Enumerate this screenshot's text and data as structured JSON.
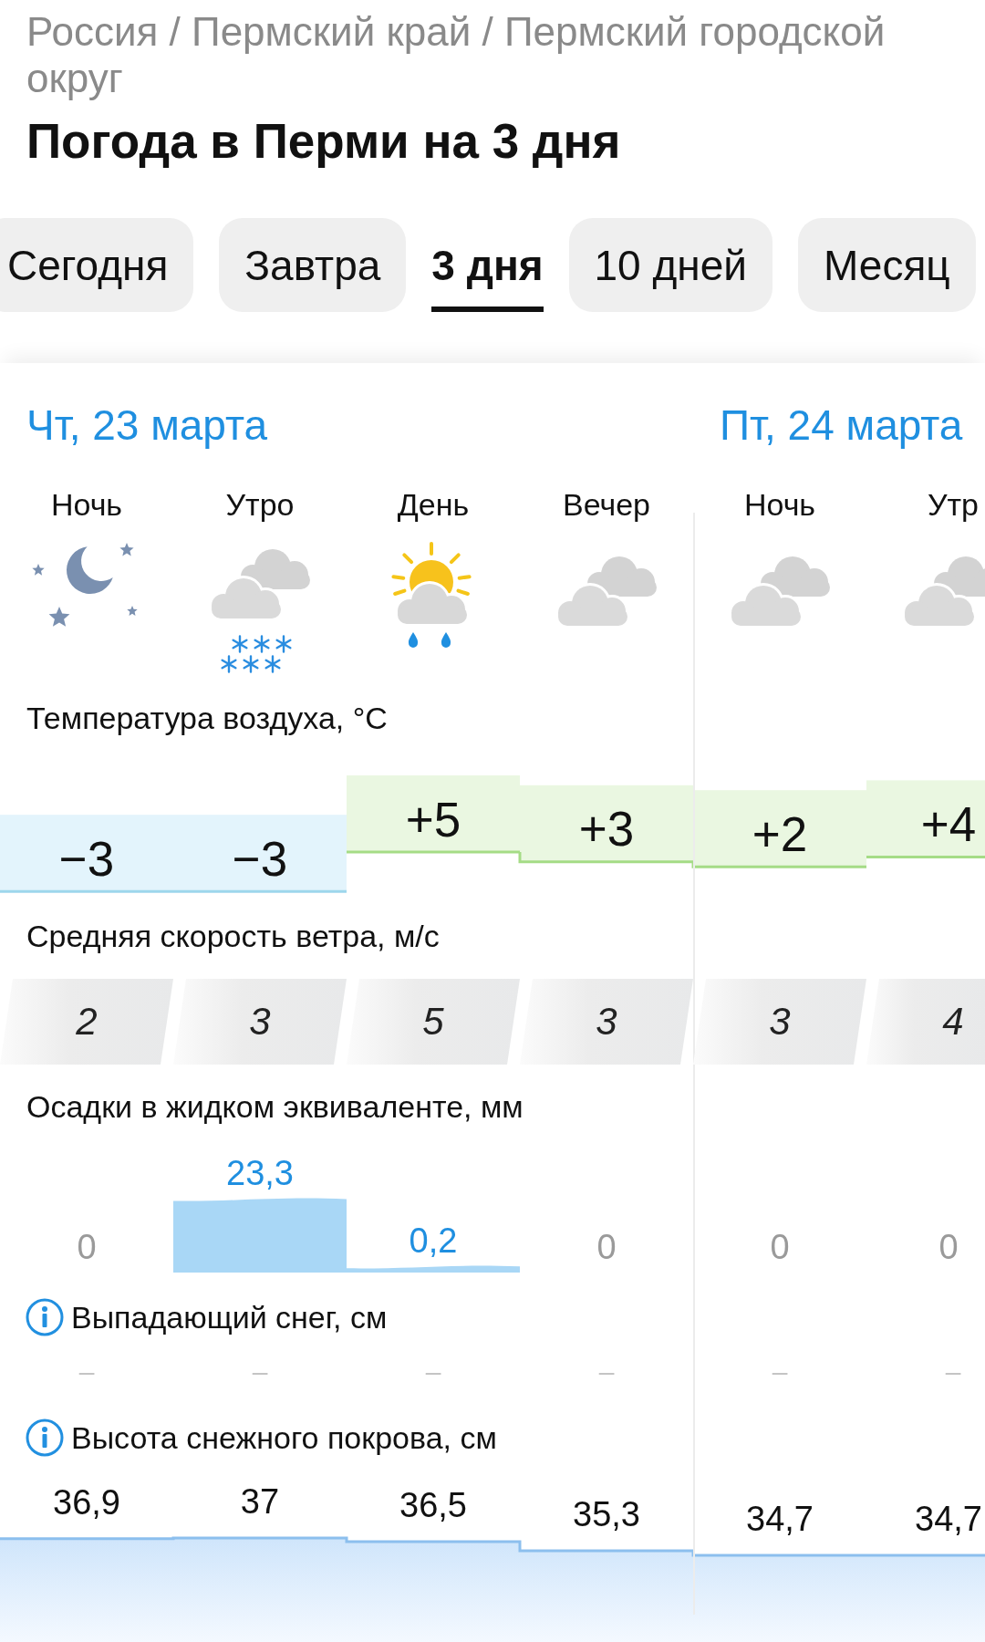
{
  "breadcrumb": {
    "items": [
      "Россия",
      "Пермский край",
      "Пермский городской округ"
    ],
    "separator": "/"
  },
  "title": "Погода в Перми на 3 дня",
  "tabs": [
    {
      "label": "Сегодня",
      "selected": false
    },
    {
      "label": "Завтра",
      "selected": false
    },
    {
      "label": "3 дня",
      "selected": true
    },
    {
      "label": "10 дней",
      "selected": false
    },
    {
      "label": "Месяц",
      "selected": false
    }
  ],
  "days": [
    {
      "label": "Чт, 23 марта",
      "periods": [
        {
          "label": "Ночь",
          "kind": "clear-night"
        },
        {
          "label": "Утро",
          "kind": "snow"
        },
        {
          "label": "День",
          "kind": "partly-cloudy-rain"
        },
        {
          "label": "Вечер",
          "kind": "overcast"
        }
      ]
    },
    {
      "label": "Пт, 24 марта",
      "periods": [
        {
          "label": "Ночь",
          "kind": "overcast"
        },
        {
          "label": "Утр",
          "kind": "overcast"
        }
      ]
    }
  ],
  "temperature": {
    "title": "Температура воздуха, °C",
    "values": [
      "−3",
      "−3",
      "+5",
      "+3",
      "+2",
      "+4"
    ]
  },
  "wind": {
    "title": "Средняя скорость ветра, м/с",
    "values": [
      "2",
      "3",
      "5",
      "3",
      "3",
      "4"
    ]
  },
  "precipitation": {
    "title": "Осадки в жидком эквиваленте, мм",
    "values": [
      "0",
      "23,3",
      "0,2",
      "0",
      "0",
      "0"
    ]
  },
  "snowfall": {
    "title": "Выпадающий снег, см",
    "values": [
      "–",
      "–",
      "–",
      "–",
      "–",
      "–"
    ]
  },
  "snow_depth": {
    "title": "Высота снежного покрова, см",
    "values": [
      "36,9",
      "37",
      "36,5",
      "35,3",
      "34,7",
      "34,7"
    ]
  }
}
